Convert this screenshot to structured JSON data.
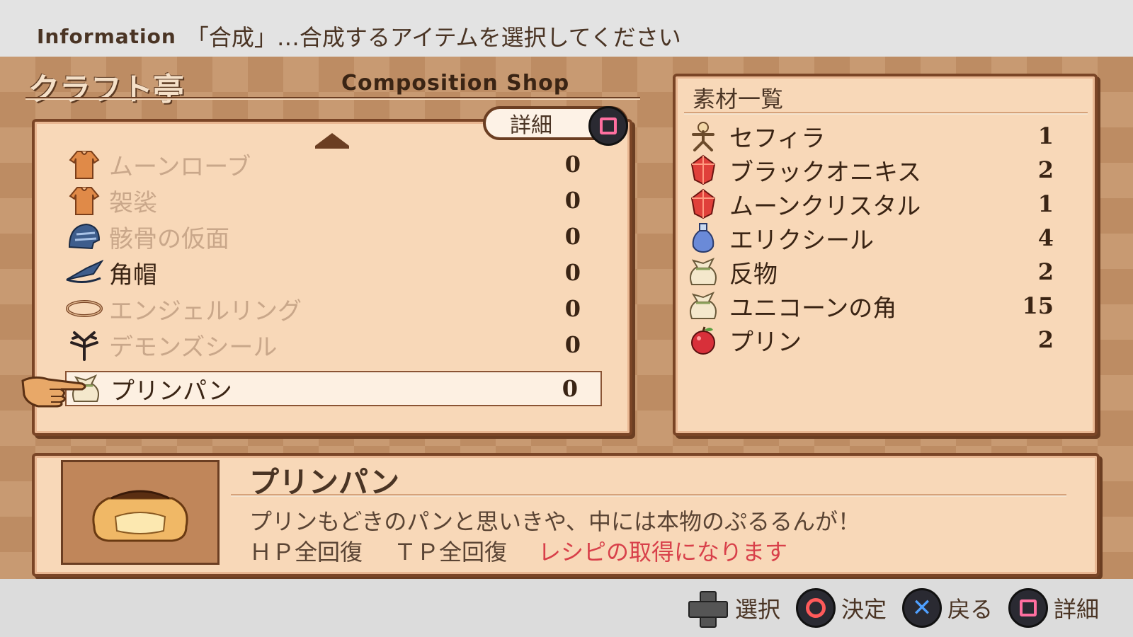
{
  "info": {
    "label": "Information",
    "text": "「合成」…合成するアイテムを選択してください"
  },
  "shop": {
    "title_jp": "クラフト亭",
    "title_en": "Composition Shop",
    "detail_tab": "詳細"
  },
  "craft_list": [
    {
      "name": "ムーンローブ",
      "qty": "0",
      "icon": "robe-icon",
      "available": false
    },
    {
      "name": "袈裟",
      "qty": "0",
      "icon": "robe-icon",
      "available": false
    },
    {
      "name": "骸骨の仮面",
      "qty": "0",
      "icon": "helmet-icon",
      "available": false
    },
    {
      "name": "角帽",
      "qty": "0",
      "icon": "hat-icon",
      "available": true
    },
    {
      "name": "エンジェルリング",
      "qty": "0",
      "icon": "ring-icon",
      "available": false
    },
    {
      "name": "デモンズシール",
      "qty": "0",
      "icon": "seal-icon",
      "available": false
    },
    {
      "name": "プリンパン",
      "qty": "0",
      "icon": "bag-icon",
      "available": true,
      "selected": true
    }
  ],
  "materials": {
    "header": "素材一覧",
    "items": [
      {
        "name": "セフィラ",
        "qty": "1",
        "icon": "figure-icon"
      },
      {
        "name": "ブラックオニキス",
        "qty": "2",
        "icon": "gem-icon"
      },
      {
        "name": "ムーンクリスタル",
        "qty": "1",
        "icon": "gem-icon"
      },
      {
        "name": "エリクシール",
        "qty": "4",
        "icon": "potion-icon"
      },
      {
        "name": "反物",
        "qty": "2",
        "icon": "bag-icon"
      },
      {
        "name": "ユニコーンの角",
        "qty": "15",
        "icon": "bag-icon"
      },
      {
        "name": "プリン",
        "qty": "2",
        "icon": "apple-icon"
      }
    ]
  },
  "detail": {
    "name": "プリンパン",
    "description": "プリンもどきのパンと思いきや、中には本物のぷるるんが！",
    "effect_hp": "ＨＰ全回復",
    "effect_tp": "ＴＰ全回復",
    "recipe_note": "レシピの取得になります"
  },
  "footer": {
    "select": "選択",
    "confirm": "決定",
    "back": "戻る",
    "detail": "詳細"
  }
}
